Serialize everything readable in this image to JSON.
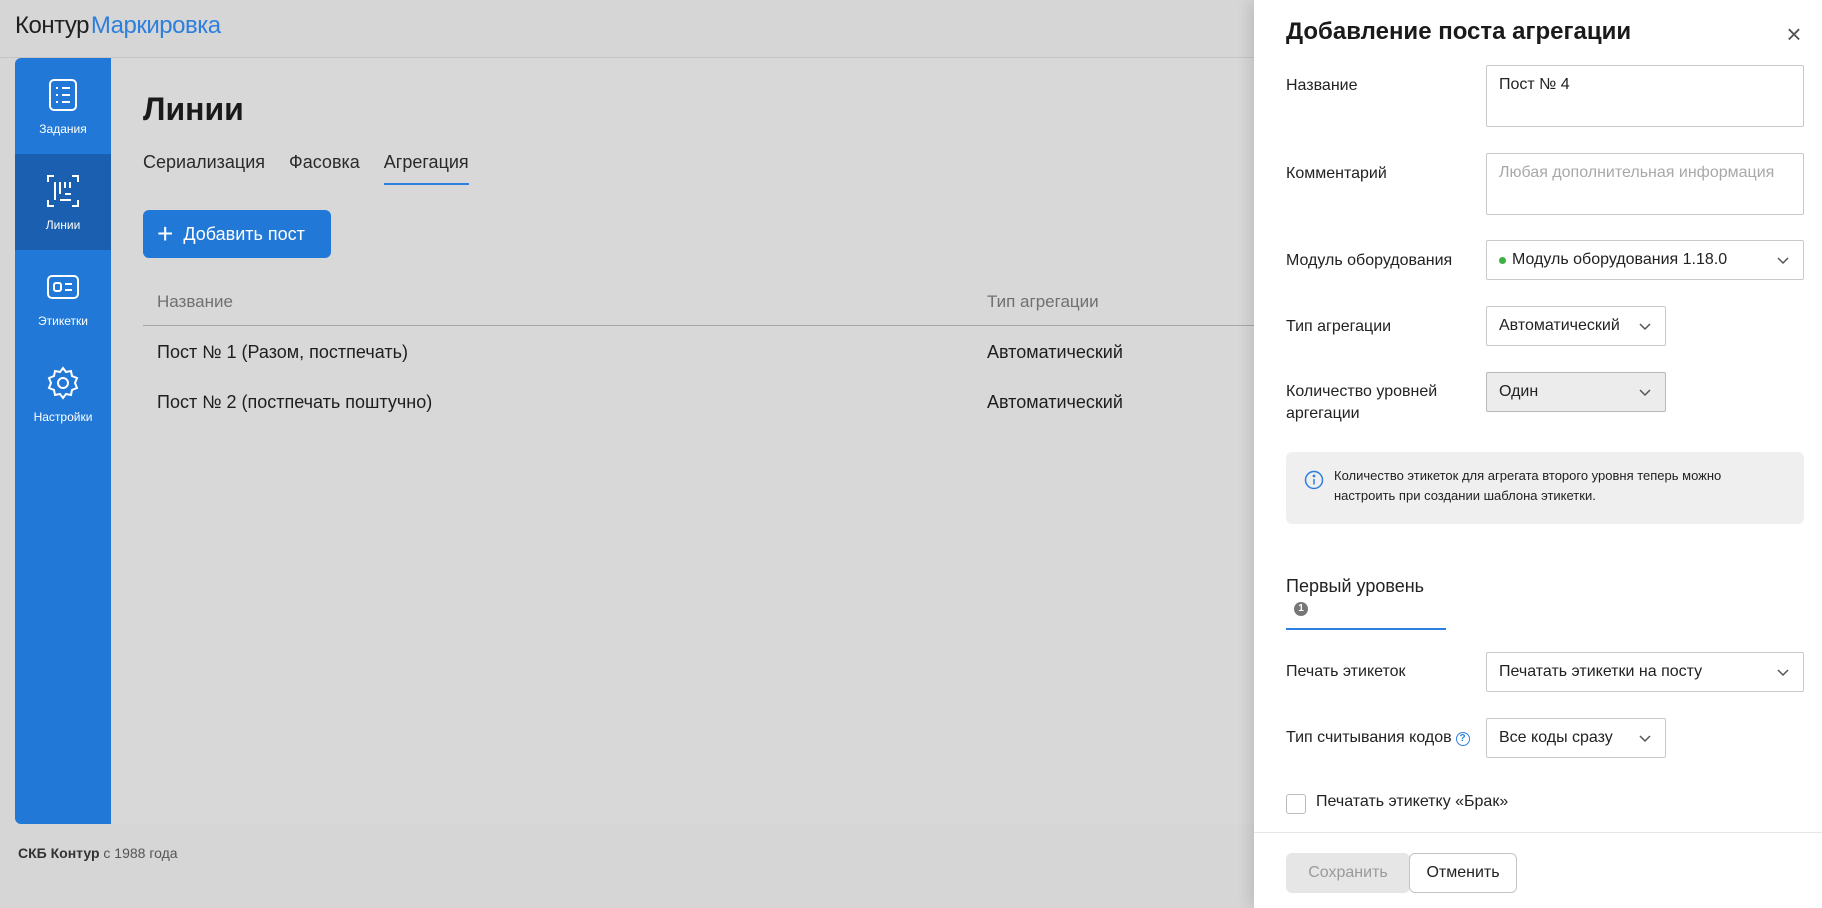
{
  "app": {
    "logo_part1": "Контур",
    "logo_part2": "Маркировка"
  },
  "sidebar": {
    "items": [
      {
        "label": "Задания",
        "icon": "tasks-icon"
      },
      {
        "label": "Линии",
        "icon": "barcode-lines-icon"
      },
      {
        "label": "Этикетки",
        "icon": "label-icon"
      },
      {
        "label": "Настройки",
        "icon": "gear-icon"
      }
    ],
    "active": "Линии"
  },
  "page": {
    "title": "Линии",
    "tabs": [
      "Сериализация",
      "Фасовка",
      "Агрегация"
    ],
    "active_tab": "Агрегация",
    "add_button": "Добавить пост",
    "table": {
      "headers": [
        "Название",
        "Тип агрегации"
      ],
      "rows": [
        {
          "name": "Пост № 1 (Разом, постпечать)",
          "type": "Автоматический"
        },
        {
          "name": "Пост № 2 (постпечать поштучно)",
          "type": "Автоматический"
        }
      ]
    }
  },
  "footer": {
    "company": "СКБ Контур",
    "since": "с 1988 года"
  },
  "panel": {
    "title": "Добавление поста агрегации",
    "name_label": "Название",
    "name_value": "Пост № 4",
    "comment_label": "Комментарий",
    "comment_placeholder": "Любая дополнительная информация",
    "module_label": "Модуль оборудования",
    "module_value": "Модуль оборудования 1.18.0",
    "agg_type_label": "Тип агрегации",
    "agg_type_value": "Автоматический",
    "levels_label_line1": "Количество уровней",
    "levels_label_line2": "аргегации",
    "levels_value": "Один",
    "info_text": "Количество этикеток для агрегата второго уровня теперь можно настроить при создании шаблона этикетки.",
    "level_tab": "Первый уровень",
    "level_tab_badge": "1",
    "print_label": "Печать этикеток",
    "print_value": "Печатать этикетки на посту",
    "scan_label": "Тип считывания кодов",
    "scan_value": "Все коды сразу",
    "defect_checkbox_label": "Печатать этикетку «Брак»",
    "save_button": "Сохранить",
    "cancel_button": "Отменить",
    "colors": {
      "accent": "#2278d6",
      "status_dot": "#3cb043"
    }
  }
}
